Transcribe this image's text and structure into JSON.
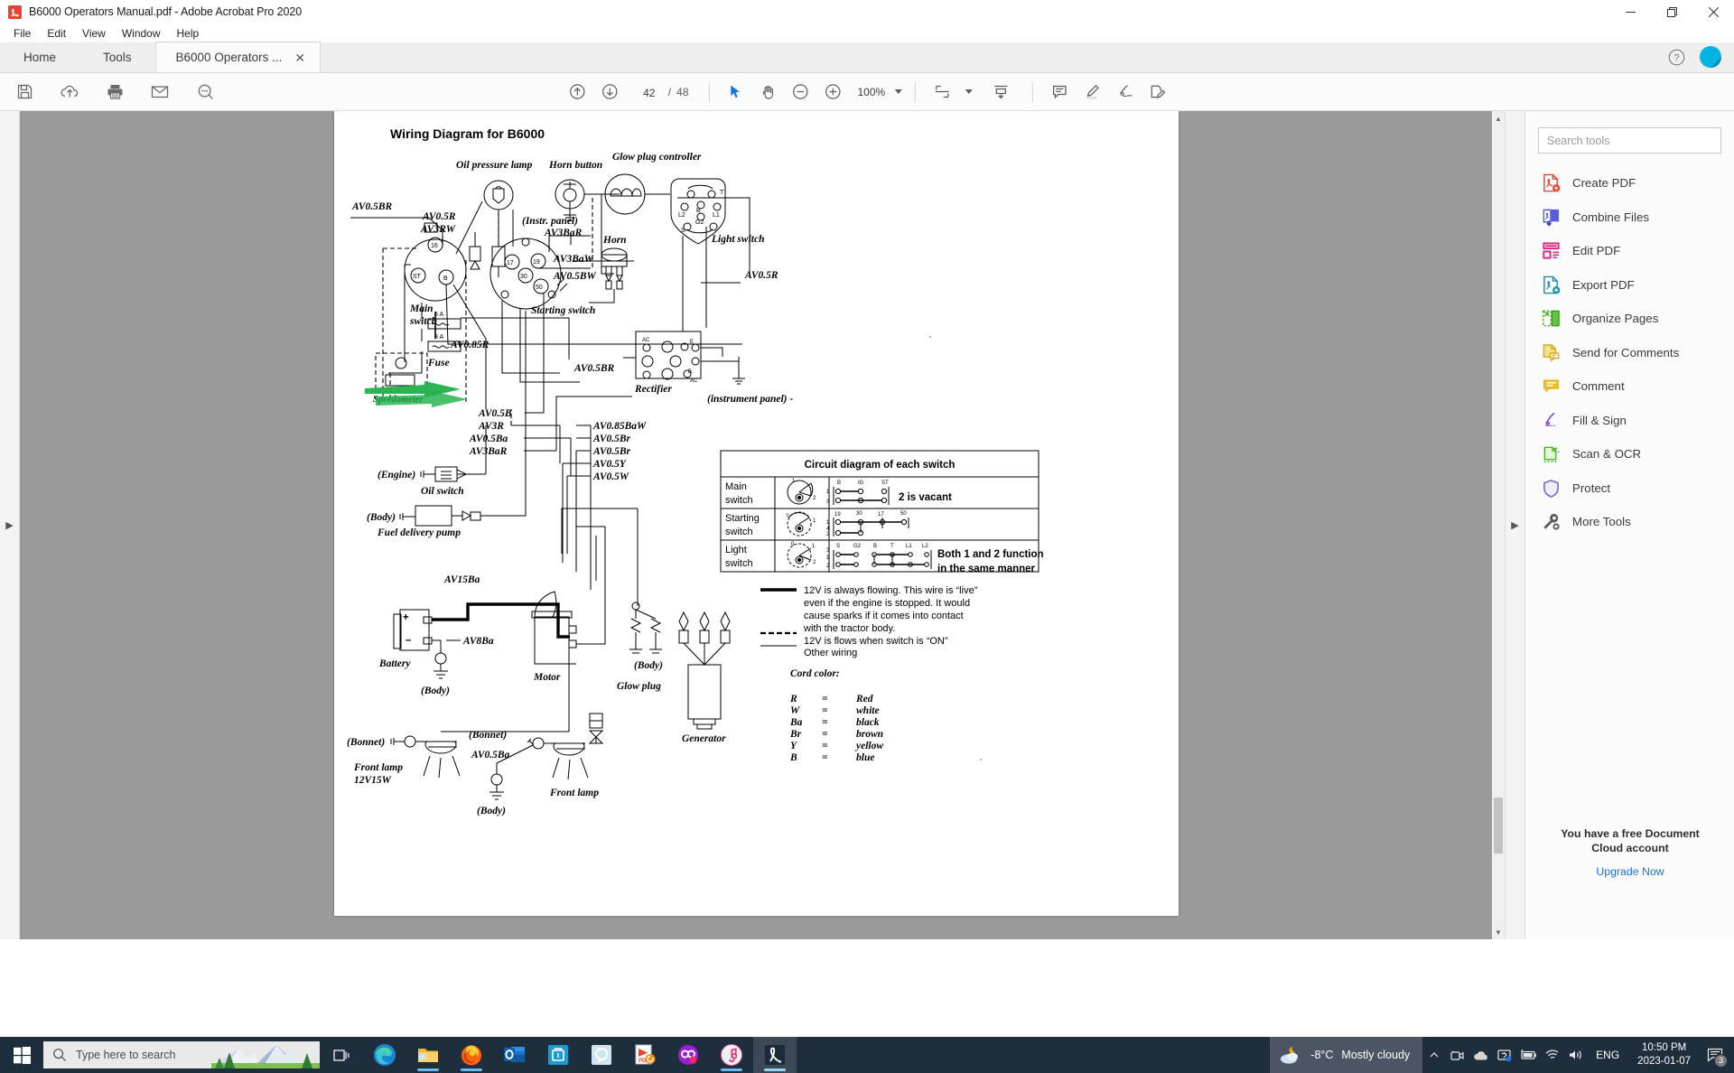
{
  "window": {
    "title": "B6000 Operators Manual.pdf - Adobe Acrobat Pro 2020",
    "app_icon": "acrobat-icon",
    "minimize": "—",
    "maximize": "❐",
    "close": "✕"
  },
  "menubar": {
    "items": [
      "File",
      "Edit",
      "View",
      "Window",
      "Help"
    ]
  },
  "tabs": {
    "home": "Home",
    "tools": "Tools",
    "document": "B6000 Operators ...",
    "close_glyph": "✕",
    "help_glyph": "?"
  },
  "toolbar": {
    "left_icons": [
      "save-icon",
      "upload-cloud-icon",
      "print-icon",
      "email-icon",
      "search-zoom-icon"
    ],
    "page_up": "↑",
    "page_down": "↓",
    "page_current": "42",
    "page_separator": "/",
    "page_total": "48",
    "select_tool": "cursor-icon",
    "hand_tool": "hand-icon",
    "zoom_out": "−",
    "zoom_in": "+",
    "zoom_level": "100%",
    "fit_page": "fit-page-icon",
    "scroll_mode": "scroll-mode-icon",
    "comment": "comment-icon",
    "highlight": "highlighter-icon",
    "sign": "sign-icon",
    "fillsign": "fill-sign-icon"
  },
  "tools_panel": {
    "search_placeholder": "Search tools",
    "items": [
      {
        "label": "Create PDF",
        "icon": "create-pdf-icon",
        "color": "#e8432f"
      },
      {
        "label": "Combine Files",
        "icon": "combine-files-icon",
        "color": "#5b5be0"
      },
      {
        "label": "Edit PDF",
        "icon": "edit-pdf-icon",
        "color": "#d6277e"
      },
      {
        "label": "Export PDF",
        "icon": "export-pdf-icon",
        "color": "#1b8ea8"
      },
      {
        "label": "Organize Pages",
        "icon": "organize-pages-icon",
        "color": "#4fb02a"
      },
      {
        "label": "Send for Comments",
        "icon": "send-comments-icon",
        "color": "#d7a81d"
      },
      {
        "label": "Comment",
        "icon": "comment-tool-icon",
        "color": "#d7a81d"
      },
      {
        "label": "Fill & Sign",
        "icon": "fill-sign-tool-icon",
        "color": "#8048d6"
      },
      {
        "label": "Scan & OCR",
        "icon": "scan-ocr-icon",
        "color": "#4fb02a"
      },
      {
        "label": "Protect",
        "icon": "protect-icon",
        "color": "#6f64c9"
      },
      {
        "label": "More Tools",
        "icon": "more-tools-icon",
        "color": "#5a5a5a"
      }
    ],
    "cloud_note_line1": "You have a free Document",
    "cloud_note_line2": "Cloud account",
    "upgrade_link": "Upgrade Now"
  },
  "document": {
    "title": "Wiring Diagram for B6000",
    "component_labels": [
      "Oil pressure lamp",
      "Horn button",
      "Glow plug controller",
      "Horn",
      "(Instr. panel)",
      "Light switch",
      "Main",
      "switch",
      "Starting switch",
      "Fuse",
      "Rectifier",
      "(instrument panel) -",
      "(Engine)",
      "Oil switch",
      "(Body)",
      "Fuel delivery pump",
      "Battery",
      "Motor",
      "Glow plug",
      "Generator",
      "(Bonnet)",
      "Front lamp",
      "12V15W",
      "Front lamp",
      "Speedometer"
    ],
    "wire_labels": [
      "AV0.5BR",
      "AV0.5R",
      "AV3RW",
      "AV3BaR",
      "AV3BaW",
      "AV0.5BW",
      "AV0.5R",
      "AV0.85R",
      "AV0.5BR",
      "AV0.5B",
      "AV3R",
      "AV0.5Ba",
      "AV3BaR",
      "AV0.85BaW",
      "AV0.5Br",
      "AV0.5Br",
      "AV0.5Y",
      "AV0.5W",
      "AV15Ba",
      "AV8Ba",
      "AV0.5Ba"
    ],
    "fuse_ratings": [
      "5 A",
      "3 A"
    ],
    "main_switch_terminals": [
      "16",
      "ST",
      "B"
    ],
    "starting_switch_terminals": [
      "17",
      "19",
      "30",
      "50"
    ],
    "light_switch_terminals": [
      "T",
      "L2",
      "B",
      "G2",
      "L1",
      "S"
    ],
    "rectifier_terminals": [
      "AC",
      "E",
      "B",
      "AC"
    ],
    "switch_table": {
      "header": "Circuit diagram of each switch",
      "rows": [
        {
          "name1": "Main",
          "name2": "switch",
          "terminals": [
            "B",
            "IG",
            "ST"
          ],
          "note": "2 is vacant"
        },
        {
          "name1": "Starting",
          "name2": "switch",
          "terminals": [
            "19",
            "30",
            "17",
            "50"
          ],
          "note": ""
        },
        {
          "name1": "Light",
          "name2": "switch",
          "terminals": [
            "S",
            "G2",
            "B",
            "T",
            "L1",
            "L2"
          ],
          "note": "Both 1 and 2 function\nin the same manner"
        }
      ],
      "light_note_l1": "Both 1 and 2 function",
      "light_note_l2": "in the same manner"
    },
    "legend": {
      "solid_lines": [
        "12V is always flowing. This wire is “live”",
        "even if the engine is stopped. It would",
        "cause sparks if it comes into contact",
        "with the tractor body."
      ],
      "dashed_line": "12V is flows when switch is “ON”",
      "thin_line": "Other wiring"
    },
    "cord_color": {
      "title": "Cord color:",
      "eq": "=",
      "rows": [
        {
          "code": "R",
          "name": "Red"
        },
        {
          "code": "W",
          "name": "white"
        },
        {
          "code": "Ba",
          "name": "black"
        },
        {
          "code": "Br",
          "name": "brown"
        },
        {
          "code": "Y",
          "name": "yellow"
        },
        {
          "code": "B",
          "name": "blue"
        }
      ]
    },
    "annotation": {
      "type": "green-arrow-highlight",
      "color": "#22b14c"
    }
  },
  "taskbar": {
    "start": "windows-logo-icon",
    "search_placeholder": "Type here to search",
    "task_view": "task-view-icon",
    "apps": [
      {
        "name": "edge-icon",
        "running": false
      },
      {
        "name": "file-explorer-icon",
        "running": true
      },
      {
        "name": "firefox-icon",
        "running": true
      },
      {
        "name": "outlook-icon",
        "running": false
      },
      {
        "name": "teams-icon",
        "running": false
      },
      {
        "name": "zoom-icon",
        "running": false
      },
      {
        "name": "pdf-converter-icon",
        "running": false
      },
      {
        "name": "infinity-app-icon",
        "running": false
      },
      {
        "name": "itunes-icon",
        "running": true
      },
      {
        "name": "acrobat-icon",
        "running": true
      }
    ],
    "tray": {
      "weather_temp": "-8°C",
      "weather_desc": "Mostly cloudy",
      "overflow": "∧",
      "icons": [
        "camera-icon",
        "onedrive-icon",
        "display-icon",
        "battery-icon",
        "wifi-icon",
        "volume-icon"
      ],
      "language": "ENG",
      "time": "10:50 PM",
      "date": "2023-01-07",
      "notifications": "3"
    }
  }
}
